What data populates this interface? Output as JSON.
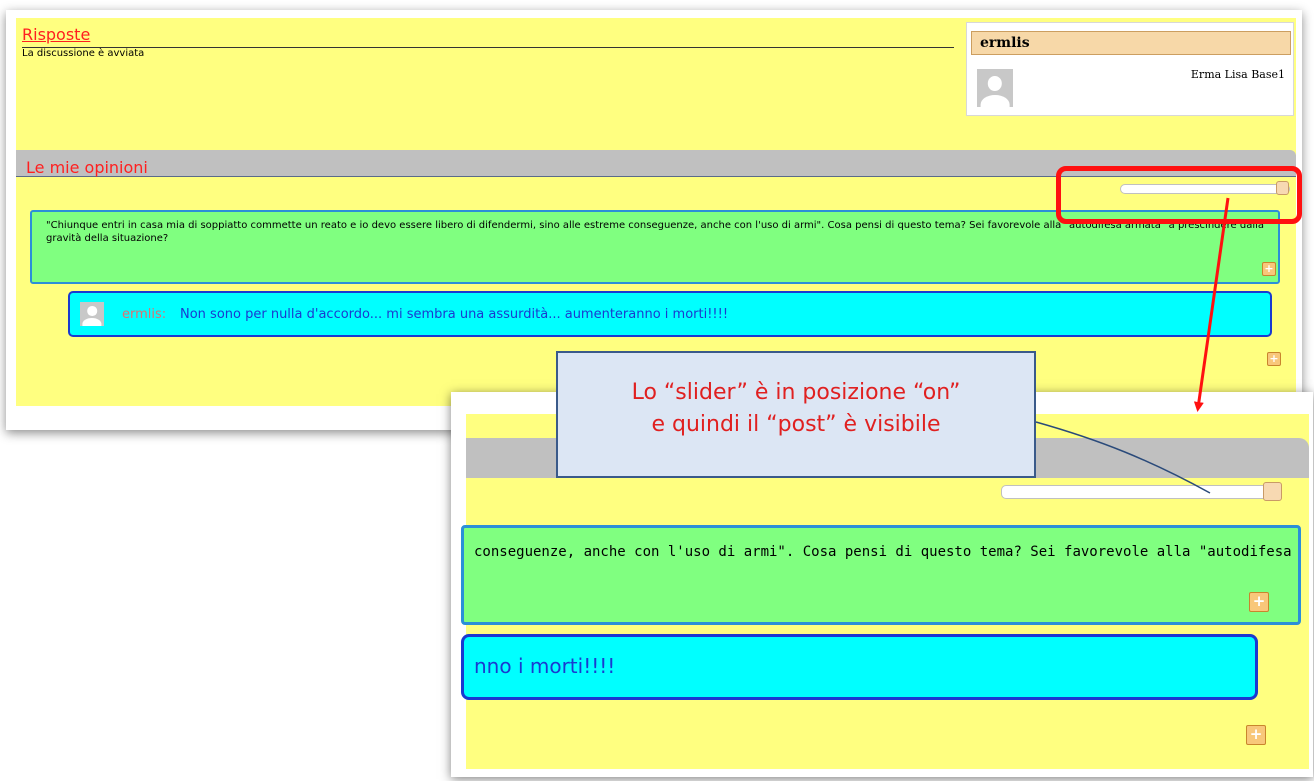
{
  "main": {
    "header": {
      "title": "Risposte",
      "subtitle": "La discussione è avviata"
    },
    "profile": {
      "username": "ermlis",
      "full_name": "Erma Lisa Base1"
    },
    "section_title": "Le mie opinioni",
    "slider_state": "on",
    "post": {
      "text": "\"Chiunque entri in casa mia di soppiatto commette un reato e io devo essere libero di difendermi, sino alle estreme conseguenze, anche con l'uso di armi\". Cosa pensi di questo tema? Sei favorevole alla \"autodifesa armata\" a prescindere dalla gravità della situazione?",
      "add_label": "+"
    },
    "reply": {
      "user": "ermlis:",
      "text": "Non sono per nulla d'accordo... mi sembra una assurdità... aumenteranno i morti!!!!"
    },
    "add_reply_label": "+"
  },
  "zoom": {
    "post_text": "conseguenze, anche con l'uso di armi\". Cosa pensi di questo tema? Sei favorevole alla \"autodifesa",
    "reply_text": "nno i morti!!!!",
    "add_label": "+"
  },
  "callout": {
    "line1": "Lo “slider” è in posizione “on”",
    "line2": "e quindi il “post” è visibile"
  },
  "colors": {
    "page_bg": "#ffff80",
    "post_bg": "#80ff80",
    "reply_bg": "#00ffff",
    "heading": "#ff1f1f",
    "highlight": "#ff1010",
    "callout_bg": "#dce6f4"
  }
}
